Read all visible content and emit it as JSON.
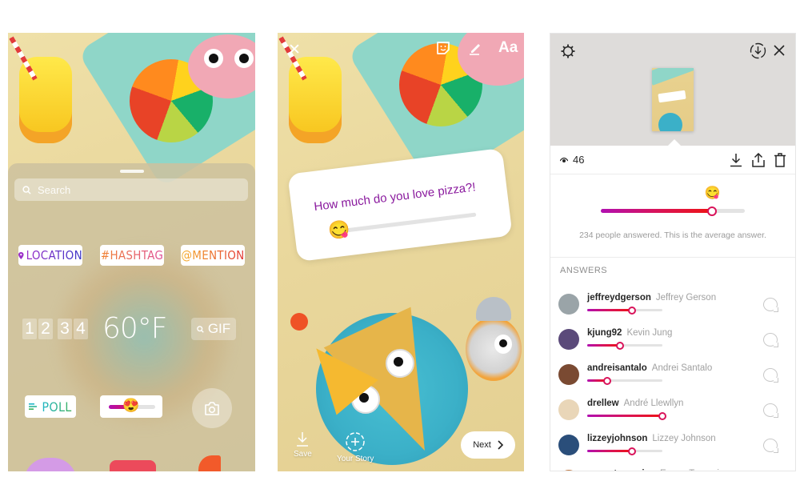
{
  "panel1": {
    "search_placeholder": "Search",
    "stickers": {
      "location": "LOCATION",
      "hashtag": "#HASHTAG",
      "mention": "@MENTION",
      "clock_digits": [
        "1",
        "2",
        "3",
        "4"
      ],
      "temperature": "60°F",
      "gif": "GIF",
      "poll": "POLL",
      "slider_emoji": "😍"
    }
  },
  "panel2": {
    "toolbar": {
      "close": "✕",
      "text_tool": "Aa"
    },
    "question": {
      "text": "How much do you love pizza?!",
      "emoji": "😋"
    },
    "bottom": {
      "save_label": "Save",
      "your_story_label": "Your Story",
      "next_label": "Next"
    }
  },
  "panel3": {
    "views_count": "46",
    "average": {
      "emoji": "😋",
      "value": 0.77,
      "summary": "234 people answered. This is the average answer."
    },
    "answers_heading": "ANSWERS",
    "answers": [
      {
        "username": "jeffreydgerson",
        "full_name": "Jeffrey Gerson",
        "value": 0.6,
        "avatar_color": "#9aa4a8"
      },
      {
        "username": "kjung92",
        "full_name": "Kevin Jung",
        "value": 0.44,
        "avatar_color": "#5b4a7a"
      },
      {
        "username": "andreisantalo",
        "full_name": "Andrei Santalo",
        "value": 0.27,
        "avatar_color": "#7a4a32"
      },
      {
        "username": "drellew",
        "full_name": "André Llewllyn",
        "value": 1.0,
        "avatar_color": "#e9d6b8"
      },
      {
        "username": "lizzeyjohnson",
        "full_name": "Lizzey Johnson",
        "value": 0.6,
        "avatar_color": "#2a4e7a"
      },
      {
        "username": "emmatangerine",
        "full_name": "Emma Tangerine",
        "value": null,
        "avatar_color": "#c47a42"
      }
    ]
  }
}
